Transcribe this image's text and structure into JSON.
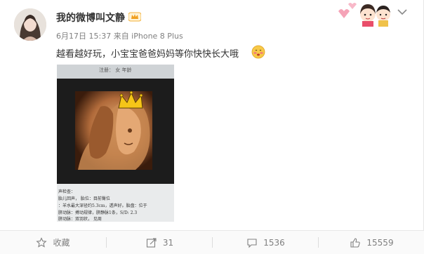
{
  "post": {
    "username": "我的微博叫文静",
    "meta": "6月17日 15:37 来自 iPhone 8 Plus",
    "text": "越看越好玩，小宝宝爸爸妈妈等你快快长大哦"
  },
  "photo_text": {
    "top": "注册：  女    年龄",
    "line1": "声检查：",
    "line2": "胎儿回声，  胎位：目前臀位",
    "line3": "：羊水最大深径约5.3cm，透声好。胎盘：位于",
    "line4": "脐动脉：搏动规律，脐静脉1条，S/D: 2.3",
    "line5": "脐动脉：双羽状，  见周"
  },
  "actions": {
    "favorite": "收藏",
    "repost": "31",
    "comment": "1536",
    "like": "15559"
  },
  "colors": {
    "text": "#333333",
    "meta": "#808080",
    "accent": "#eb7350"
  }
}
